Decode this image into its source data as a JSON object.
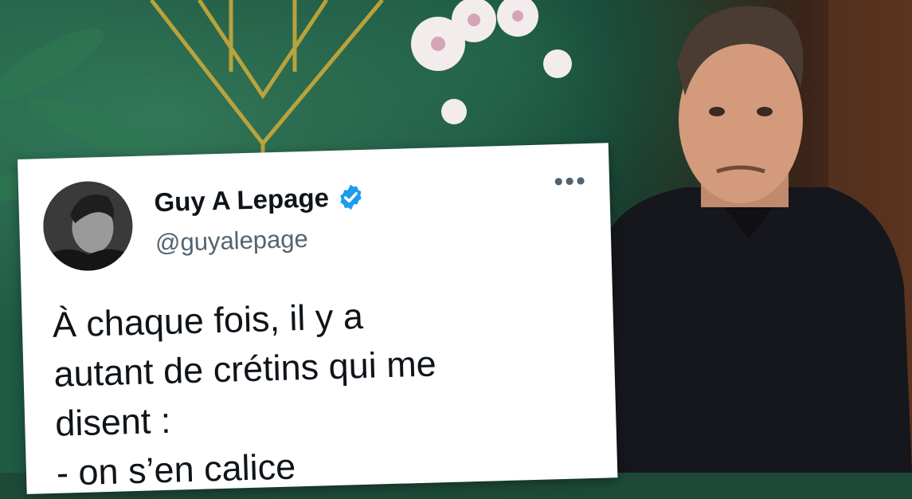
{
  "tweet": {
    "display_name": "Guy A Lepage",
    "handle": "@guyalepage",
    "text": "À chaque fois, il y a\nautant de crétins qui me\ndisent :\n- on s’en calice"
  },
  "icons": {
    "verified": "verified-badge-icon",
    "more": "more-options-icon"
  },
  "colors": {
    "verified": "#1d9bf0",
    "name": "#0f1419",
    "handle": "#536471"
  }
}
